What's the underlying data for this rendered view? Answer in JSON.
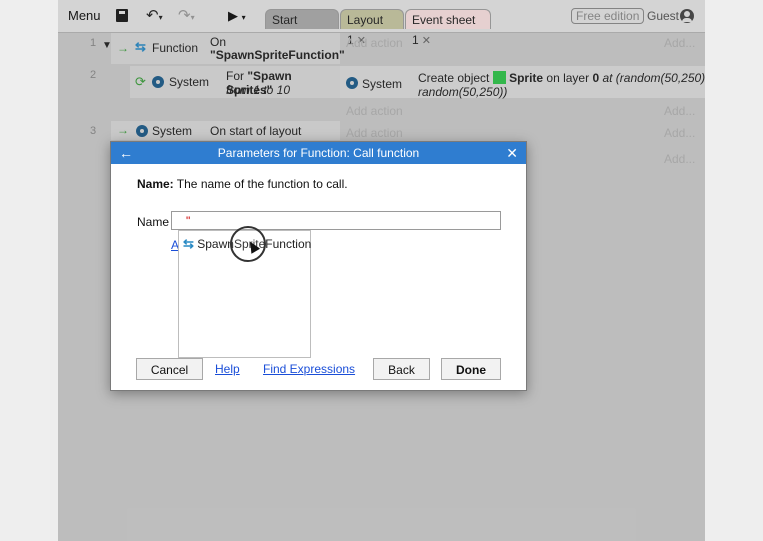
{
  "toolbar": {
    "menu_label": "Menu",
    "tabs": [
      {
        "label": "Start page"
      },
      {
        "label": "Layout 1"
      },
      {
        "label": "Event sheet 1"
      }
    ],
    "edition_badge": "Free edition",
    "user_label": "Guest"
  },
  "events": {
    "row1": {
      "number": "1",
      "condition_object": "Function",
      "condition_line1": "On",
      "condition_line2": "\"SpawnSpriteFunction\"",
      "add_action": "Add action",
      "add_link": "Add..."
    },
    "row2": {
      "number": "2",
      "condition_object": "System",
      "condition_line1_prefix": "For ",
      "condition_line1_bold": "\"Spawn Sprites\"",
      "condition_line2": "from 1 to 10",
      "action_object": "System",
      "action_prefix": "Create object ",
      "action_object_name": "Sprite",
      "action_mid": " on layer ",
      "action_layer": "0",
      "action_suffix": " at (random(50,250),",
      "action_line2": "random(50,250))",
      "add_action": "Add action",
      "add_link": "Add..."
    },
    "row3": {
      "number": "3",
      "condition_object": "System",
      "condition_text": "On start of layout",
      "add_action": "Add action",
      "add_link": "Add..."
    },
    "bottom_add_link": "Add..."
  },
  "dialog": {
    "title": "Parameters for Function: Call function",
    "desc_label": "Name:",
    "desc_text": " The name of the function to call.",
    "name_label": "Name",
    "name_value": "\"",
    "hidden_link": "Ad",
    "autocomplete_item": "SpawnSpriteFunction",
    "cancel_label": "Cancel",
    "help_label": "Help",
    "find_label": "Find Expressions",
    "back_label": "Back",
    "done_label": "Done"
  },
  "colors": {
    "accent": "#2f7dd0",
    "sprite": "#2fc24a"
  }
}
